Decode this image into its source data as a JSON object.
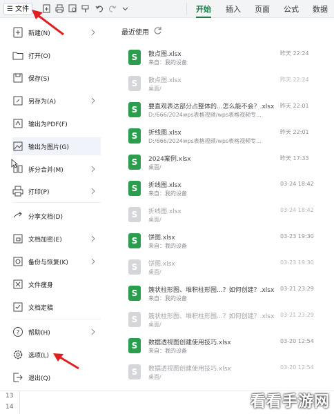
{
  "toolbar": {
    "file_label": "☰ 文件",
    "tabs": [
      "开始",
      "插入",
      "页面",
      "公式",
      "数据"
    ]
  },
  "menu": {
    "items": [
      {
        "label": "新建(N)",
        "icon": "new-file-icon",
        "arrow": true
      },
      {
        "label": "打开(O)",
        "icon": "folder-icon",
        "arrow": false
      },
      {
        "label": "保存(S)",
        "icon": "save-icon",
        "arrow": false
      },
      {
        "label": "另存为(A)",
        "icon": "save-as-icon",
        "arrow": true
      },
      {
        "label": "输出为PDF(F)",
        "icon": "pdf-icon",
        "arrow": false
      },
      {
        "label": "输出为图片(G)",
        "icon": "image-icon",
        "arrow": false
      },
      {
        "label": "拆分合并(M)",
        "icon": "split-merge-icon",
        "arrow": true
      },
      {
        "label": "打印(P)",
        "icon": "print-icon",
        "arrow": true
      },
      {
        "label": "分享文档(D)",
        "icon": "share-icon",
        "arrow": false
      },
      {
        "label": "文档加密(E)",
        "icon": "encrypt-icon",
        "arrow": true
      },
      {
        "label": "备份与恢复(K)",
        "icon": "backup-icon",
        "arrow": true
      },
      {
        "label": "文件瘦身",
        "icon": "slim-icon",
        "arrow": false
      },
      {
        "label": "文档定稿",
        "icon": "finalize-icon",
        "arrow": false
      },
      {
        "label": "帮助(H)",
        "icon": "help-icon",
        "arrow": true
      },
      {
        "label": "选项(L)",
        "icon": "gear-icon",
        "arrow": false
      },
      {
        "label": "退出(Q)",
        "icon": "exit-icon",
        "arrow": false
      }
    ]
  },
  "recent": {
    "title": "最近使用",
    "files": [
      {
        "name": "散点图.xlsx",
        "location": "来自：我的设备",
        "time": "昨天 22:24",
        "faded": false
      },
      {
        "name": "散点图.xlsx",
        "location": "桌面/",
        "time": "昨天 22:24",
        "faded": true
      },
      {
        "name": "要直观表达部分占整体的...怎么能不会？.xlsx",
        "location": "D:/666/2024wps表格视频/wps表格视频专...",
        "time": "昨天 22:01",
        "faded": false
      },
      {
        "name": "折线图.xlsx",
        "location": "D:/666/2024wps表格视频/wps表格视频专...",
        "time": "昨天 22:01",
        "faded": false
      },
      {
        "name": "2024案例.xlsx",
        "location": "桌面/",
        "time": "昨天 17:33",
        "faded": false
      },
      {
        "name": "折线图.xlsx",
        "location": "来自：我的设备",
        "time": "03-24 18:42",
        "faded": false
      },
      {
        "name": "折线图.xlsx",
        "location": "桌面/",
        "time": "03-24 18:42",
        "faded": true
      },
      {
        "name": "饼图.xlsx",
        "location": "来自：我的设备",
        "time": "03-23 19:30",
        "faded": false
      },
      {
        "name": "饼图.xlsx",
        "location": "桌面/",
        "time": "03-23 19:30",
        "faded": true
      },
      {
        "name": "簇状柱形图、堆积柱形图...？如何创建？.xlsx",
        "location": "来自：我的设备",
        "time": "03-21 23:29",
        "faded": false
      },
      {
        "name": "簇状柱形图、堆积柱形图...？如何创建？.xlsx",
        "location": "桌面/",
        "time": "03-21 23:29",
        "faded": true
      },
      {
        "name": "数据透视图创建使用技巧.xlsx",
        "location": "来自：我的设备",
        "time": "03-20 12:54",
        "faded": false
      },
      {
        "name": "数据透视图创建使用技巧.xlsx",
        "location": "桌面/",
        "time": "03-20 12:54",
        "faded": true
      }
    ]
  },
  "sheet": {
    "row_numbers": [
      "13",
      "14"
    ]
  },
  "watermark": "看看手游网",
  "colors": {
    "accent": "#1d7a45",
    "xls_green": "#2b9e4e",
    "annotation_red": "#e02020"
  }
}
